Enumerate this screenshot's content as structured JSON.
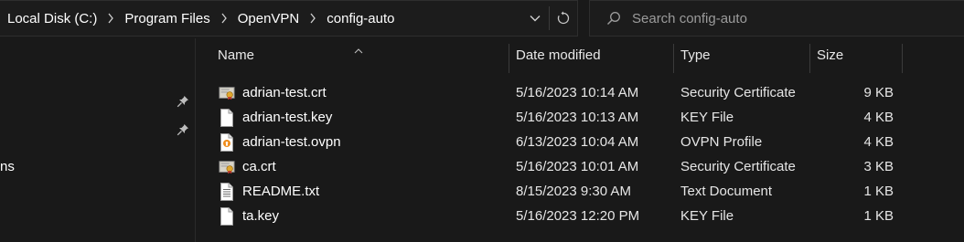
{
  "address_bar": {
    "breadcrumbs": [
      "Local Disk (C:)",
      "Program Files",
      "OpenVPN",
      "config-auto"
    ]
  },
  "search": {
    "placeholder": "Search config-auto"
  },
  "nav": {
    "partial_label": "ns"
  },
  "columns": {
    "name": "Name",
    "date": "Date modified",
    "type": "Type",
    "size": "Size"
  },
  "files": [
    {
      "name": "adrian-test.crt",
      "date": "5/16/2023 10:14 AM",
      "type": "Security Certificate",
      "size": "9 KB",
      "icon": "certificate-icon"
    },
    {
      "name": "adrian-test.key",
      "date": "5/16/2023 10:13 AM",
      "type": "KEY File",
      "size": "4 KB",
      "icon": "blank-file-icon"
    },
    {
      "name": "adrian-test.ovpn",
      "date": "6/13/2023 10:04 AM",
      "type": "OVPN Profile",
      "size": "4 KB",
      "icon": "ovpn-file-icon"
    },
    {
      "name": "ca.crt",
      "date": "5/16/2023 10:01 AM",
      "type": "Security Certificate",
      "size": "3 KB",
      "icon": "certificate-icon"
    },
    {
      "name": "README.txt",
      "date": "8/15/2023 9:30 AM",
      "type": "Text Document",
      "size": "1 KB",
      "icon": "text-file-icon"
    },
    {
      "name": "ta.key",
      "date": "5/16/2023 12:20 PM",
      "type": "KEY File",
      "size": "1 KB",
      "icon": "blank-file-icon"
    }
  ]
}
